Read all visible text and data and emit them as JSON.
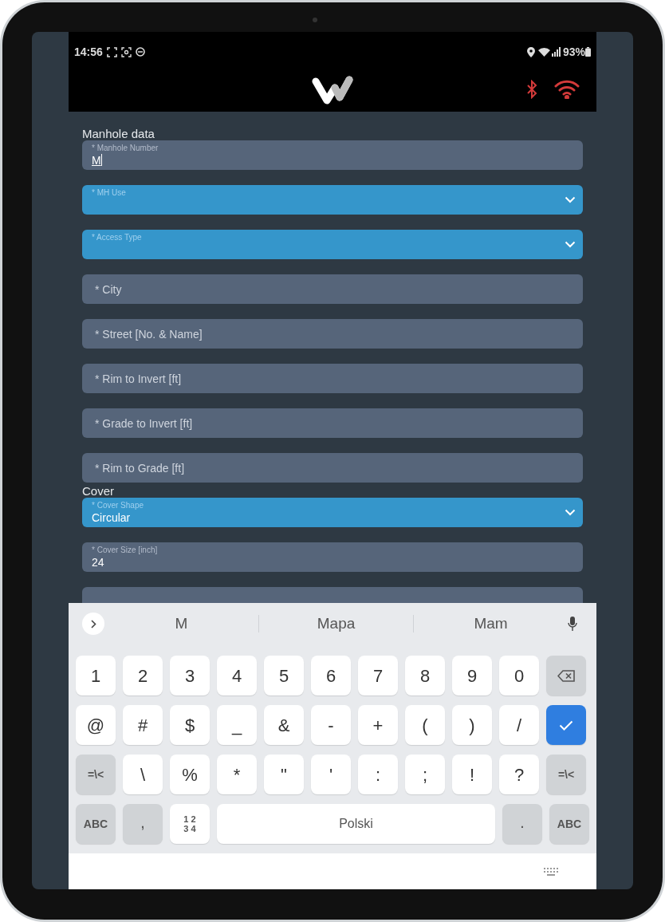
{
  "status_bar": {
    "time": "14:56",
    "battery": "93%"
  },
  "sections": [
    {
      "title": "Manhole data",
      "fields": [
        {
          "kind": "text",
          "label": "* Manhole Number",
          "value": "M",
          "focused": true
        },
        {
          "kind": "select",
          "label": "* MH Use",
          "focused": false
        },
        {
          "kind": "select",
          "label": "* Access Type",
          "focused": false
        },
        {
          "kind": "text",
          "placeholder": "* City",
          "focused": false
        },
        {
          "kind": "text",
          "placeholder": "* Street [No. & Name]",
          "focused": false
        },
        {
          "kind": "text",
          "placeholder": "* Rim to Invert [ft]",
          "focused": false
        },
        {
          "kind": "text",
          "placeholder": "* Grade to Invert [ft]",
          "focused": false
        },
        {
          "kind": "text",
          "placeholder": "* Rim to Grade [ft]",
          "focused": false
        }
      ]
    },
    {
      "title": "Cover",
      "fields": [
        {
          "kind": "select",
          "label": "* Cover Shape",
          "value": "Circular",
          "focused": false
        },
        {
          "kind": "text",
          "label": "* Cover Size [inch]",
          "value": "24",
          "focused": false
        },
        {
          "kind": "text",
          "focused": false
        }
      ]
    }
  ],
  "keyboard": {
    "suggestions": [
      "M",
      "Mapa",
      "Mam"
    ],
    "rows": [
      [
        {
          "kind": "char",
          "label": "1"
        },
        {
          "kind": "char",
          "label": "2"
        },
        {
          "kind": "char",
          "label": "3"
        },
        {
          "kind": "char",
          "label": "4"
        },
        {
          "kind": "char",
          "label": "5"
        },
        {
          "kind": "char",
          "label": "6"
        },
        {
          "kind": "char",
          "label": "7"
        },
        {
          "kind": "char",
          "label": "8"
        },
        {
          "kind": "char",
          "label": "9"
        },
        {
          "kind": "char",
          "label": "0"
        },
        {
          "kind": "backspace"
        }
      ],
      [
        {
          "kind": "char",
          "label": "@"
        },
        {
          "kind": "char",
          "label": "#"
        },
        {
          "kind": "char",
          "label": "$"
        },
        {
          "kind": "char",
          "label": "_"
        },
        {
          "kind": "char",
          "label": "&"
        },
        {
          "kind": "char",
          "label": "-"
        },
        {
          "kind": "char",
          "label": "+"
        },
        {
          "kind": "char",
          "label": "("
        },
        {
          "kind": "char",
          "label": ")"
        },
        {
          "kind": "char",
          "label": "/"
        },
        {
          "kind": "enter"
        }
      ],
      [
        {
          "kind": "function",
          "label": "=\\<"
        },
        {
          "kind": "char",
          "label": "\\"
        },
        {
          "kind": "char",
          "label": "%"
        },
        {
          "kind": "char",
          "label": "*"
        },
        {
          "kind": "char",
          "label": "\""
        },
        {
          "kind": "char",
          "label": "'"
        },
        {
          "kind": "char",
          "label": ":"
        },
        {
          "kind": "char",
          "label": ";"
        },
        {
          "kind": "char",
          "label": "!"
        },
        {
          "kind": "char",
          "label": "?"
        },
        {
          "kind": "function",
          "label": "=\\<"
        }
      ]
    ],
    "bottom_row": {
      "left_keys": [
        {
          "kind": "function",
          "label": "ABC"
        },
        {
          "kind": "function",
          "label": ","
        },
        {
          "kind": "numpad",
          "lines": [
            "1 2",
            "3 4"
          ]
        }
      ],
      "space_key": "Polski",
      "right_keys": [
        {
          "kind": "function",
          "label": "."
        },
        {
          "kind": "function",
          "label": "ABC"
        }
      ]
    }
  }
}
